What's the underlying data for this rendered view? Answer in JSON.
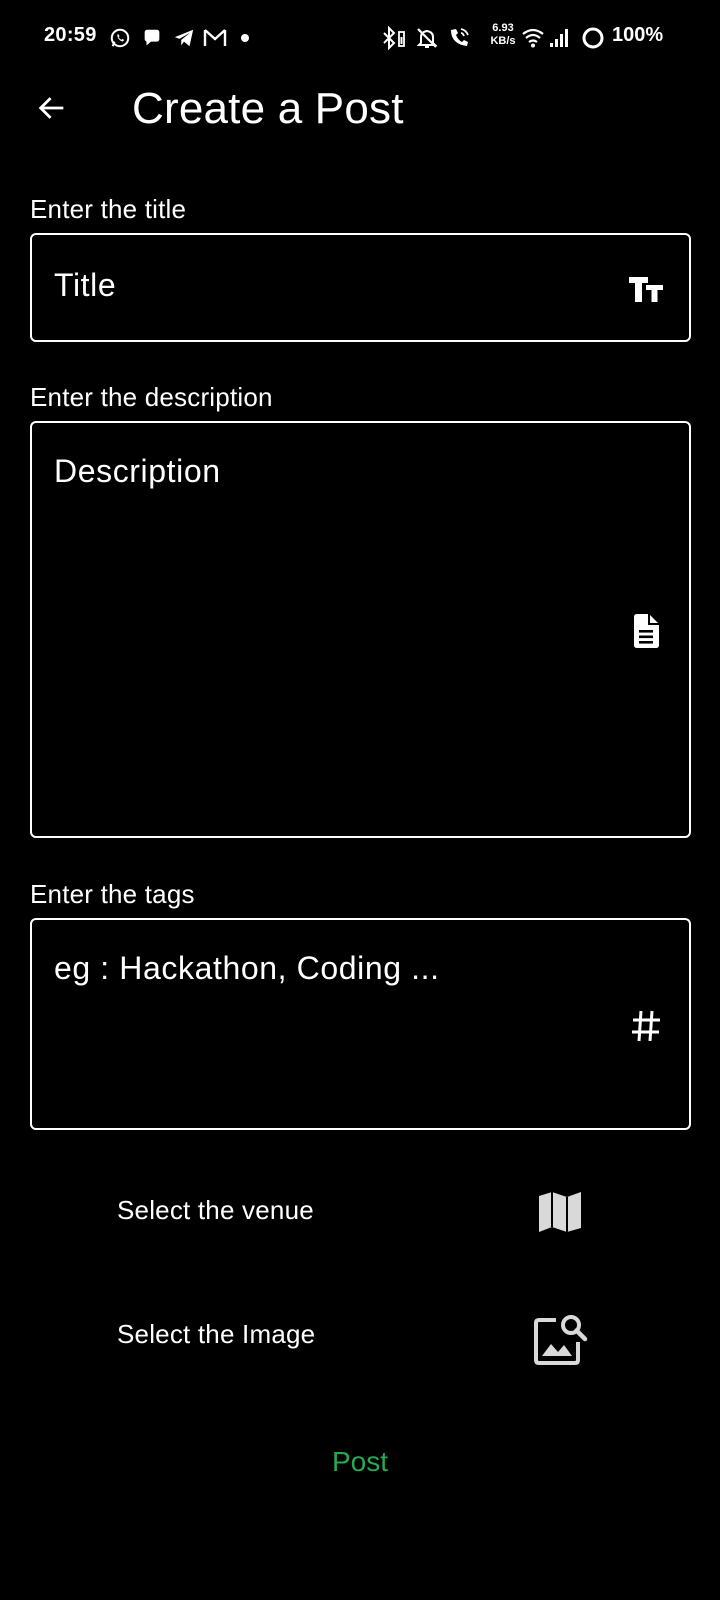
{
  "status_bar": {
    "time": "20:59",
    "netspeed_value": "6.93",
    "netspeed_unit": "KB/s",
    "battery": "100%",
    "icons": [
      "whatsapp-icon",
      "chat-icon",
      "telegram-icon",
      "gmail-icon",
      "dot-icon",
      "bluetooth-icon",
      "mute-icon",
      "wifi-call-icon",
      "wifi-icon",
      "signal-icon",
      "battery-icon"
    ]
  },
  "app_bar": {
    "title": "Create a Post",
    "back_icon": "arrow-back-icon"
  },
  "form": {
    "title_label": "Enter the title",
    "title_placeholder": "Title",
    "title_icon": "text-size-icon",
    "description_label": "Enter the description",
    "description_placeholder": "Description",
    "description_icon": "document-icon",
    "tags_label": "Enter the tags",
    "tags_placeholder": "eg : Hackathon, Coding ...",
    "tags_icon": "hashtag-icon"
  },
  "actions": {
    "venue_label": "Select the venue",
    "venue_icon": "map-icon",
    "image_label": "Select the Image",
    "image_icon": "image-search-icon",
    "post_label": "Post"
  },
  "colors": {
    "background": "#000000",
    "text": "#ffffff",
    "accent": "#27a852",
    "muted_icon": "#d9d9d9"
  }
}
